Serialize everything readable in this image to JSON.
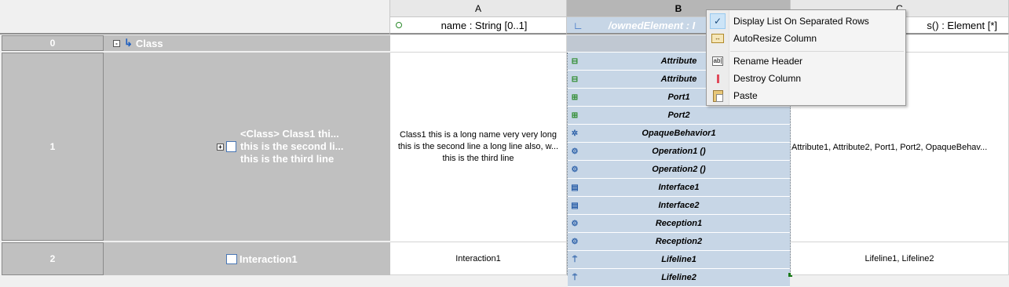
{
  "columns": {
    "a_letter": "A",
    "b_letter": "B",
    "c_letter": "C",
    "a_header": "name : String [0..1]",
    "b_header": "/ownedElement : I",
    "c_header": "s() : Element [*]"
  },
  "rows": [
    {
      "index": "0",
      "title": "Class"
    },
    {
      "index": "1",
      "title_lines": [
        "<Class> Class1 thi...",
        "this is the second li...",
        "this is the third line"
      ],
      "a_lines": [
        "Class1 this is a long name very very long",
        "this is the second line a long line also, w...",
        "this is the third line"
      ],
      "c_value": "Attribute1, Attribute2, Port1, Port2, OpaqueBehav..."
    },
    {
      "index": "2",
      "title": "Interaction1",
      "a_value": "Interaction1",
      "c_value": "Lifeline1, Lifeline2"
    }
  ],
  "owned_elements": [
    {
      "label": "Attribute",
      "icon": "attribute-icon"
    },
    {
      "label": "Attribute",
      "icon": "attribute-icon"
    },
    {
      "label": "Port1",
      "icon": "port-icon"
    },
    {
      "label": "Port2",
      "icon": "port-icon"
    },
    {
      "label": "OpaqueBehavior1",
      "icon": "behavior-icon"
    },
    {
      "label": "Operation1 ()",
      "icon": "operation-icon"
    },
    {
      "label": "Operation2 ()",
      "icon": "operation-icon"
    },
    {
      "label": "Interface1",
      "icon": "interface-icon"
    },
    {
      "label": "Interface2",
      "icon": "interface-icon"
    },
    {
      "label": "Reception1",
      "icon": "reception-icon"
    },
    {
      "label": "Reception2",
      "icon": "reception-icon"
    },
    {
      "label": "Lifeline1",
      "icon": "lifeline-icon"
    },
    {
      "label": "Lifeline2",
      "icon": "lifeline-icon"
    }
  ],
  "context_menu": {
    "items": [
      {
        "label": "Display List On Separated Rows",
        "icon": "checkmark-icon"
      },
      {
        "label": "AutoResize Column",
        "icon": "autoresize-icon"
      },
      {
        "label": "Rename Header",
        "icon": "rename-icon"
      },
      {
        "label": "Destroy Column",
        "icon": "destroy-icon"
      },
      {
        "label": "Paste",
        "icon": "paste-icon"
      }
    ]
  }
}
